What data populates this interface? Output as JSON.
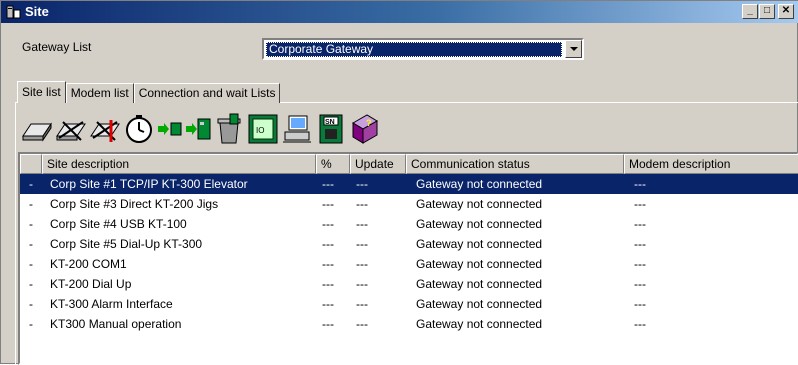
{
  "window": {
    "title": "Site"
  },
  "gateway": {
    "label": "Gateway List",
    "selected": "Corporate Gateway"
  },
  "tabs": [
    {
      "label": "Site list",
      "active": true
    },
    {
      "label": "Modem list",
      "active": false
    },
    {
      "label": "Connection and wait Lists",
      "active": false
    }
  ],
  "toolbar": {
    "icons": [
      "connect-icon",
      "disconnect-icon",
      "disconnect-alarm-icon",
      "timer-icon",
      "transfer-right-icon",
      "transfer-board-icon",
      "trash-icon",
      "board-settings-icon",
      "network-computer-icon",
      "serial-number-icon",
      "help-book-icon"
    ]
  },
  "table": {
    "columns": [
      "",
      "Site description",
      "%",
      "Update",
      "Communication status",
      "Modem description"
    ],
    "rows": [
      [
        "-",
        "Corp Site #1 TCP/IP KT-300 Elevator",
        "---",
        "---",
        "Gateway not connected",
        "---"
      ],
      [
        "-",
        "Corp Site #3  Direct KT-200 Jigs",
        "---",
        "---",
        "Gateway not connected",
        "---"
      ],
      [
        "-",
        "Corp Site #4 USB KT-100",
        "---",
        "---",
        "Gateway not connected",
        "---"
      ],
      [
        "-",
        "Corp Site #5 Dial-Up KT-300",
        "---",
        "---",
        "Gateway not connected",
        "---"
      ],
      [
        "-",
        "KT-200  COM1",
        "---",
        "---",
        "Gateway not connected",
        "---"
      ],
      [
        "-",
        "KT-200 Dial Up",
        "---",
        "---",
        "Gateway not connected",
        "---"
      ],
      [
        "-",
        "KT-300 Alarm Interface",
        "---",
        "---",
        "Gateway not connected",
        "---"
      ],
      [
        "-",
        "KT300 Manual operation",
        "---",
        "---",
        "Gateway not connected",
        "---"
      ]
    ],
    "selected_row": 0
  },
  "colors": {
    "selection": "#0a246a",
    "face": "#d4d0c8"
  }
}
